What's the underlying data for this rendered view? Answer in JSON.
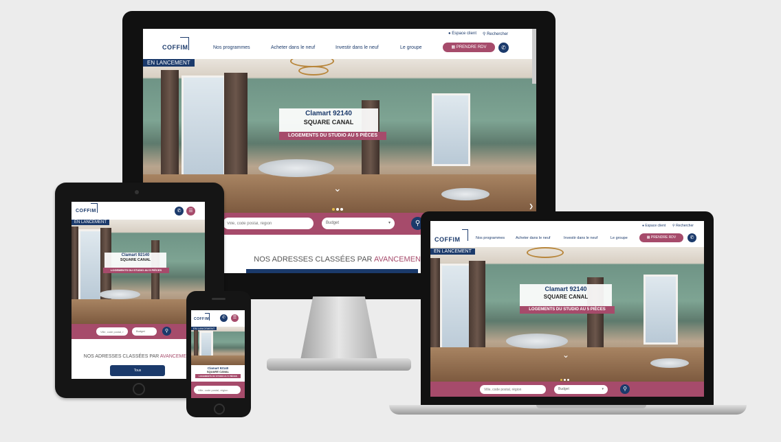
{
  "site": {
    "logo": "COFFIM",
    "nav": [
      "Nos programmes",
      "Acheter dans le neuf",
      "Investir dans le neuf",
      "Le groupe"
    ],
    "util_account": "Espace client",
    "util_search": "Rechercher",
    "cta_label": "PRENDRE RDV",
    "launch_badge": "EN LANCEMENT",
    "hero_city": "Clamart 92140",
    "hero_name": "SQUARE CANAL",
    "hero_type": "LOGEMENTS DU STUDIO AU 5 PIÈCES",
    "search_placeholder": "Ville, code postal, région",
    "select_value": "Budget",
    "section_title_main": "NOS ADRESSES CLASSÉES PAR ",
    "section_title_accent": "AVANCEMENT",
    "tab_label": "Tous"
  },
  "icons": {
    "calendar": "calendar-icon",
    "phone": "phone-icon",
    "menu": "menu-icon",
    "search": "search-icon",
    "chevron_down": "chevron-down-icon",
    "arrow_next": "chevron-right-icon",
    "location": "location-pin-icon"
  },
  "colors": {
    "brand_navy": "#1b3a6b",
    "brand_rose": "#a64b6b",
    "dot_active": "#e0b84b"
  }
}
